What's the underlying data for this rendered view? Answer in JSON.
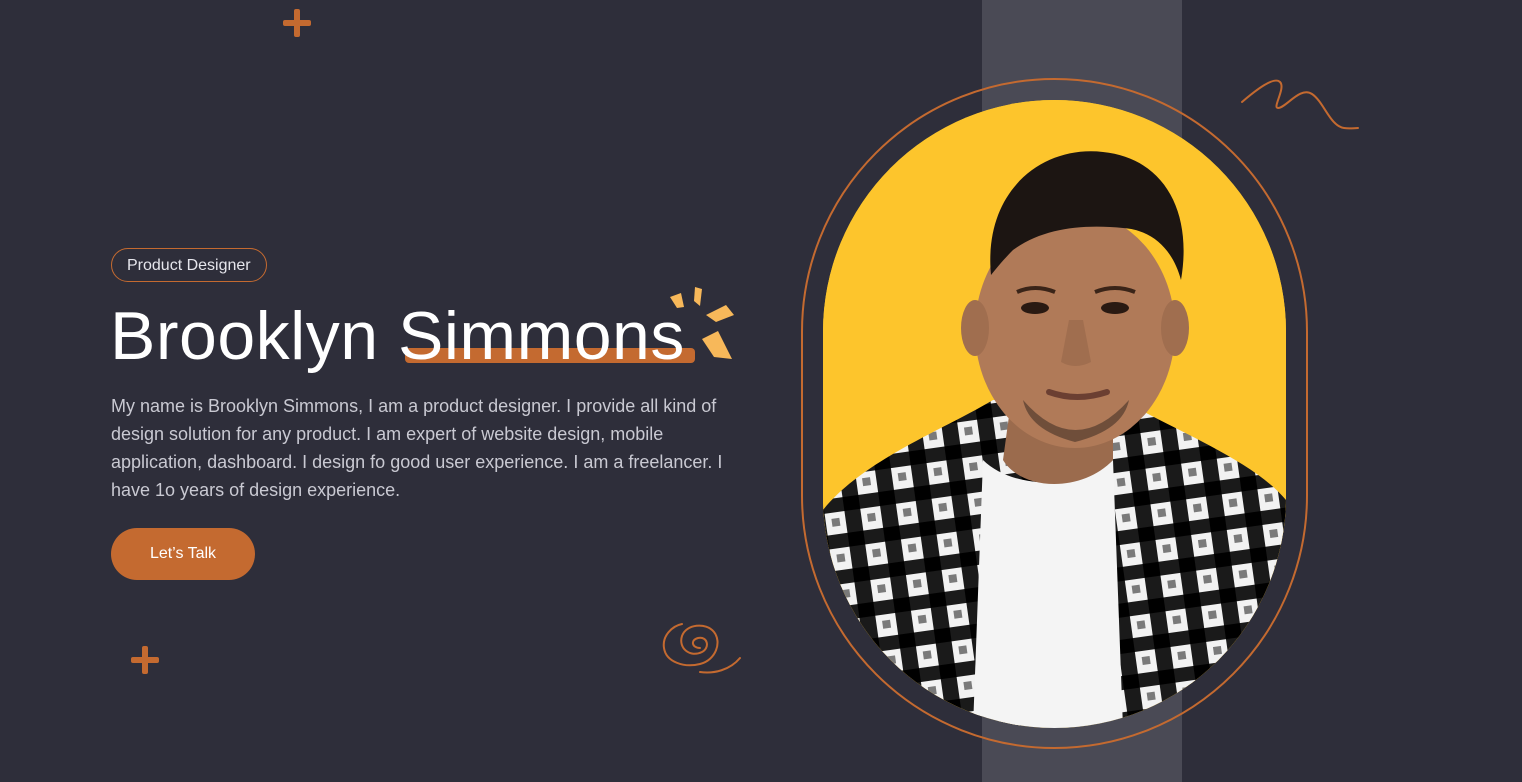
{
  "hero": {
    "badge": "Product Designer",
    "first_name": "Brooklyn",
    "last_name": "Simmons",
    "description": "My name is Brooklyn Simmons, I am a product designer. I provide all kind of design solution for any product. I am expert of website design, mobile application, dashboard. I design fo good user experience. I am a freelancer. I have 1o years of design experience.",
    "cta_label": "Let’s Talk"
  },
  "colors": {
    "background": "#2e2e3a",
    "accent": "#c46a30",
    "stripe": "#4a4a55",
    "portrait_bg": "#fdc52c",
    "spark": "#f7b85a"
  },
  "icons": {
    "top_plus": "plus-icon",
    "bottom_plus": "plus-icon",
    "sparkle": "sparkle-icon",
    "swirl": "swirl-doodle",
    "squiggle": "squiggle-doodle"
  }
}
